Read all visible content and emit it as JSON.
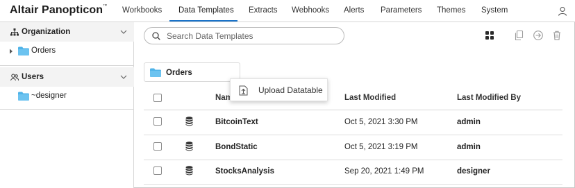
{
  "app": {
    "brand": "Altair Panopticon",
    "brand_mark": "™"
  },
  "nav": {
    "items": [
      {
        "label": "Workbooks"
      },
      {
        "label": "Data Templates",
        "active": true
      },
      {
        "label": "Extracts"
      },
      {
        "label": "Webhooks"
      },
      {
        "label": "Alerts"
      },
      {
        "label": "Parameters"
      },
      {
        "label": "Themes"
      },
      {
        "label": "System"
      }
    ],
    "user_icon": "user-icon"
  },
  "sidebar": {
    "organization": {
      "title": "Organization",
      "icon": "organization-icon",
      "items": [
        {
          "label": "Orders",
          "expanded": false
        }
      ]
    },
    "users": {
      "title": "Users",
      "icon": "users-icon",
      "items": [
        {
          "label": "~designer"
        }
      ]
    }
  },
  "search": {
    "placeholder": "Search Data Templates",
    "value": ""
  },
  "toolbar": {
    "icons": [
      "grid-view-icon",
      "copy-icon",
      "move-icon",
      "delete-icon"
    ]
  },
  "breadcrumb": {
    "folder": "Orders"
  },
  "context_menu": {
    "items": [
      {
        "label": "Upload Datatable",
        "icon": "upload-file-icon"
      }
    ]
  },
  "table": {
    "columns": {
      "name": "Nam",
      "last_modified": "Last Modified",
      "last_modified_by": "Last Modified By"
    },
    "rows": [
      {
        "name": "BitcoinText",
        "last_modified": "Oct 5, 2021 3:30 PM",
        "last_modified_by": "admin"
      },
      {
        "name": "BondStatic",
        "last_modified": "Oct 5, 2021 3:19 PM",
        "last_modified_by": "admin"
      },
      {
        "name": "StocksAnalysis",
        "last_modified": "Sep 20, 2021 1:49 PM",
        "last_modified_by": "designer"
      }
    ]
  },
  "colors": {
    "accent": "#1a73c9",
    "folder": "#4fb3e8",
    "header_bg": "#f3f3f3"
  }
}
